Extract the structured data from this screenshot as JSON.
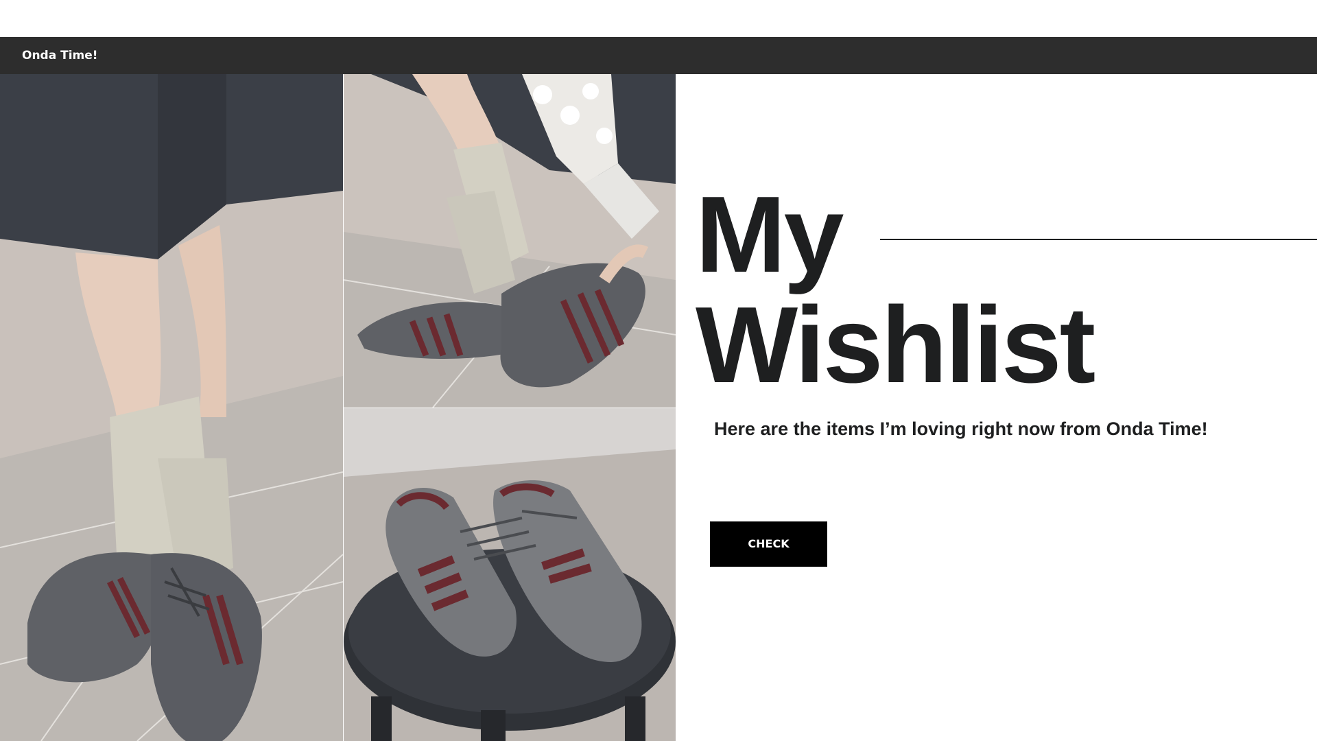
{
  "header": {
    "brand": "Onda Time!"
  },
  "hero": {
    "title_line1": "My",
    "title_line2": "Wishlist",
    "subtitle": "Here are the items I’m loving right now from Onda Time!",
    "cta_label": "CHECK"
  },
  "images": [
    {
      "name": "photo-sneakers-standing",
      "description_icon": "sneaker-photo"
    },
    {
      "name": "photo-sneakers-leaning",
      "description_icon": "sneaker-photo"
    },
    {
      "name": "photo-sneakers-on-stool",
      "description_icon": "sneaker-photo"
    }
  ],
  "colors": {
    "topbar": "#2d2d2d",
    "text": "#1e1f20",
    "cta_bg": "#000000",
    "cta_text": "#ffffff",
    "sneaker_suede": "#5f6166",
    "sneaker_stripe": "#6b2a30",
    "sock": "#d3d0c3",
    "skirt": "#3c4048",
    "floor": "#b9b4ae"
  }
}
